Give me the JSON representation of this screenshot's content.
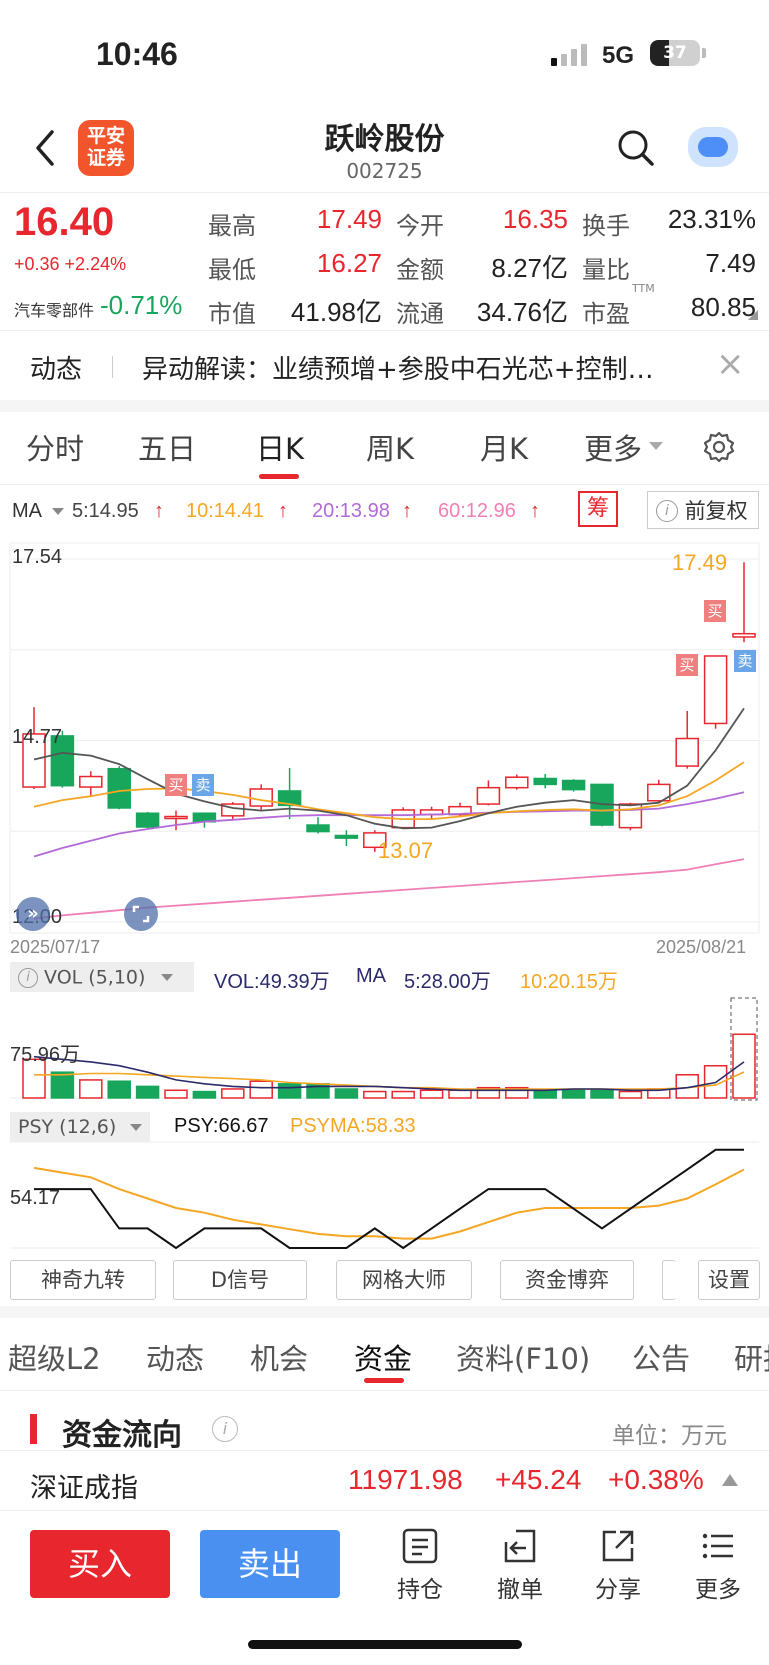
{
  "status_bar": {
    "time": "10:46",
    "network": "5G",
    "battery": "37"
  },
  "nav": {
    "logo_text_1": "平安",
    "logo_text_2": "证券",
    "stock_name": "跃岭股份",
    "stock_code": "002725"
  },
  "quote": {
    "price": "16.40",
    "change": "+0.36 +2.24%",
    "sector_name": "汽车零部件",
    "sector_change": "-0.71%",
    "high_label": "最高",
    "high": "17.49",
    "open_label": "今开",
    "open": "16.35",
    "turnover_label": "换手",
    "turnover": "23.31%",
    "low_label": "最低",
    "low": "16.27",
    "amount_label": "金额",
    "amount": "8.27亿",
    "vol_ratio_label": "量比",
    "vol_ratio": "7.49",
    "mktcap_label": "市值",
    "mktcap": "41.98亿",
    "float_label": "流通",
    "float": "34.76亿",
    "pe_label": "市盈",
    "pe_sup": "TTM",
    "pe": "80.85"
  },
  "news": {
    "tag": "动态",
    "text": "异动解读：业绩预增+参股中石光芯+控制…",
    "close": "×"
  },
  "period_tabs": [
    "分时",
    "五日",
    "日K",
    "周K",
    "月K",
    "更多"
  ],
  "ma_bar": {
    "ma_label": "MA",
    "ma5": "5:14.95",
    "ma10": "10:14.41",
    "ma20": "20:13.98",
    "ma60": "60:12.96",
    "arrow": "↑",
    "chip_button": "筹",
    "adjust_button": "前复权"
  },
  "kline": {
    "y_top": "17.54",
    "y_mid": "14.77",
    "y_bottom": "12.00",
    "start_date": "2025/07/17",
    "end_date": "2025/08/21",
    "max_label": "17.49",
    "min_label": "13.07",
    "buy_tag": "买",
    "sell_tag": "卖"
  },
  "volume": {
    "header": "VOL (5,10)",
    "vol": "VOL:49.39万",
    "ma_label": "MA",
    "ma5": "5:28.00万",
    "ma10": "10:20.15万",
    "y_label": "75.96万"
  },
  "psy": {
    "header": "PSY (12,6)",
    "psy": "PSY:66.67",
    "psyma": "PSYMA:58.33",
    "y_label": "54.17"
  },
  "feature_buttons": [
    "神奇九转",
    "D信号",
    "网格大师",
    "资金博弈",
    "设置"
  ],
  "bottom_tabs": [
    "超级L2",
    "动态",
    "机会",
    "资金",
    "资料(F10)",
    "公告",
    "研报"
  ],
  "fund_flow": {
    "title": "资金流向",
    "unit": "单位：万元",
    "index_name": "深证成指",
    "index_value": "11971.98",
    "index_change": "+45.24",
    "index_pct": "+0.38%"
  },
  "bottom_bar": {
    "buy": "买入",
    "sell": "卖出",
    "holdings": "持仓",
    "cancel": "撤单",
    "share": "分享",
    "more": "更多"
  },
  "colors": {
    "up": "#e8262d",
    "down": "#18a55c",
    "ma5": "#555555",
    "ma10": "#f5a623",
    "ma20": "#b36ad8",
    "ma60": "#f07fb5",
    "accent_blue": "#4a90f0"
  },
  "chart_data": {
    "type": "candlestick",
    "dates": [
      "2025/07/17",
      "2025/08/21"
    ],
    "ylim": [
      12.0,
      17.54
    ],
    "candles": [
      {
        "o": 14.06,
        "c": 14.87,
        "h": 15.28,
        "l": 14.03
      },
      {
        "o": 14.84,
        "c": 14.08,
        "h": 14.92,
        "l": 14.05
      },
      {
        "o": 14.06,
        "c": 14.22,
        "h": 14.3,
        "l": 13.92
      },
      {
        "o": 14.34,
        "c": 13.74,
        "h": 14.38,
        "l": 13.72
      },
      {
        "o": 13.66,
        "c": 13.45,
        "h": 13.68,
        "l": 13.42
      },
      {
        "o": 13.58,
        "c": 13.61,
        "h": 13.7,
        "l": 13.4
      },
      {
        "o": 13.66,
        "c": 13.53,
        "h": 13.66,
        "l": 13.44
      },
      {
        "o": 13.62,
        "c": 13.8,
        "h": 13.83,
        "l": 13.55
      },
      {
        "o": 13.77,
        "c": 14.03,
        "h": 14.1,
        "l": 13.7
      },
      {
        "o": 14.0,
        "c": 13.78,
        "h": 14.35,
        "l": 13.57
      },
      {
        "o": 13.48,
        "c": 13.38,
        "h": 13.6,
        "l": 13.35
      },
      {
        "o": 13.32,
        "c": 13.28,
        "h": 13.4,
        "l": 13.16
      },
      {
        "o": 13.14,
        "c": 13.36,
        "h": 13.4,
        "l": 13.07
      },
      {
        "o": 13.44,
        "c": 13.71,
        "h": 13.75,
        "l": 13.42
      },
      {
        "o": 13.64,
        "c": 13.71,
        "h": 13.76,
        "l": 13.58
      },
      {
        "o": 13.64,
        "c": 13.76,
        "h": 13.82,
        "l": 13.6
      },
      {
        "o": 13.8,
        "c": 14.05,
        "h": 14.16,
        "l": 13.78
      },
      {
        "o": 14.05,
        "c": 14.21,
        "h": 14.25,
        "l": 14.02
      },
      {
        "o": 14.19,
        "c": 14.1,
        "h": 14.26,
        "l": 14.04
      },
      {
        "o": 14.16,
        "c": 14.02,
        "h": 14.18,
        "l": 13.99
      },
      {
        "o": 14.1,
        "c": 13.48,
        "h": 14.1,
        "l": 13.46
      },
      {
        "o": 13.44,
        "c": 13.8,
        "h": 13.82,
        "l": 13.4
      },
      {
        "o": 13.85,
        "c": 14.1,
        "h": 14.17,
        "l": 13.82
      },
      {
        "o": 14.38,
        "c": 14.8,
        "h": 15.22,
        "l": 14.34
      },
      {
        "o": 15.03,
        "c": 16.06,
        "h": 16.06,
        "l": 14.95
      },
      {
        "o": 16.35,
        "c": 16.4,
        "h": 17.49,
        "l": 16.27
      }
    ],
    "ma5": [
      14.48,
      14.58,
      14.54,
      14.41,
      14.18,
      13.96,
      13.84,
      13.74,
      13.7,
      13.73,
      13.7,
      13.63,
      13.5,
      13.43,
      13.44,
      13.54,
      13.66,
      13.76,
      13.82,
      13.86,
      13.8,
      13.78,
      13.82,
      14.08,
      14.62,
      15.26
    ],
    "ma10": [
      13.76,
      13.86,
      13.92,
      14.0,
      14.03,
      14.04,
      14.0,
      13.94,
      13.86,
      13.8,
      13.72,
      13.66,
      13.6,
      13.57,
      13.57,
      13.61,
      13.66,
      13.69,
      13.71,
      13.72,
      13.7,
      13.72,
      13.78,
      13.92,
      14.16,
      14.44
    ],
    "ma20": [
      13.0,
      13.13,
      13.24,
      13.35,
      13.42,
      13.48,
      13.53,
      13.56,
      13.59,
      13.62,
      13.63,
      13.63,
      13.63,
      13.63,
      13.64,
      13.65,
      13.67,
      13.68,
      13.69,
      13.7,
      13.7,
      13.71,
      13.73,
      13.8,
      13.88,
      13.98
    ],
    "ma60": [
      12.05,
      12.1,
      12.14,
      12.18,
      12.22,
      12.25,
      12.28,
      12.31,
      12.34,
      12.37,
      12.4,
      12.43,
      12.46,
      12.49,
      12.52,
      12.55,
      12.58,
      12.61,
      12.64,
      12.67,
      12.7,
      12.73,
      12.76,
      12.8,
      12.88,
      12.96
    ],
    "volume": [
      30,
      20,
      14,
      13,
      9,
      6,
      5,
      7,
      13,
      11,
      11,
      7,
      5,
      5,
      6,
      6,
      8,
      8,
      6,
      6,
      6,
      5,
      7,
      18,
      25,
      49.39
    ],
    "volume_ylim": [
      0,
      75.96
    ],
    "vol_ma5": [
      32,
      30,
      28,
      25,
      20,
      14,
      11,
      9,
      8,
      8,
      9,
      9,
      9,
      8,
      7,
      6,
      6,
      6,
      6,
      7,
      7,
      6,
      6,
      8,
      12,
      28
    ],
    "vol_ma10": [
      18,
      18,
      19,
      19,
      18,
      17,
      16,
      15,
      14,
      12,
      11,
      10,
      9,
      8,
      8,
      7,
      7,
      7,
      7,
      7,
      7,
      7,
      7,
      8,
      10,
      20.15
    ],
    "psy": [
      50,
      50,
      50,
      33.3,
      33.3,
      25,
      33.3,
      33.3,
      33.3,
      25,
      25,
      25,
      33.3,
      25,
      33.3,
      41.7,
      50,
      50,
      50,
      41.7,
      33.3,
      41.7,
      50,
      58.3,
      66.7,
      66.7
    ],
    "psyma": [
      59,
      57,
      55,
      50,
      46,
      42,
      40,
      37,
      35,
      33,
      31,
      30,
      30,
      29,
      29,
      32,
      36,
      40,
      42,
      42,
      42,
      42,
      43,
      46,
      52,
      58.33
    ],
    "psy_ylim": [
      25,
      70
    ]
  }
}
